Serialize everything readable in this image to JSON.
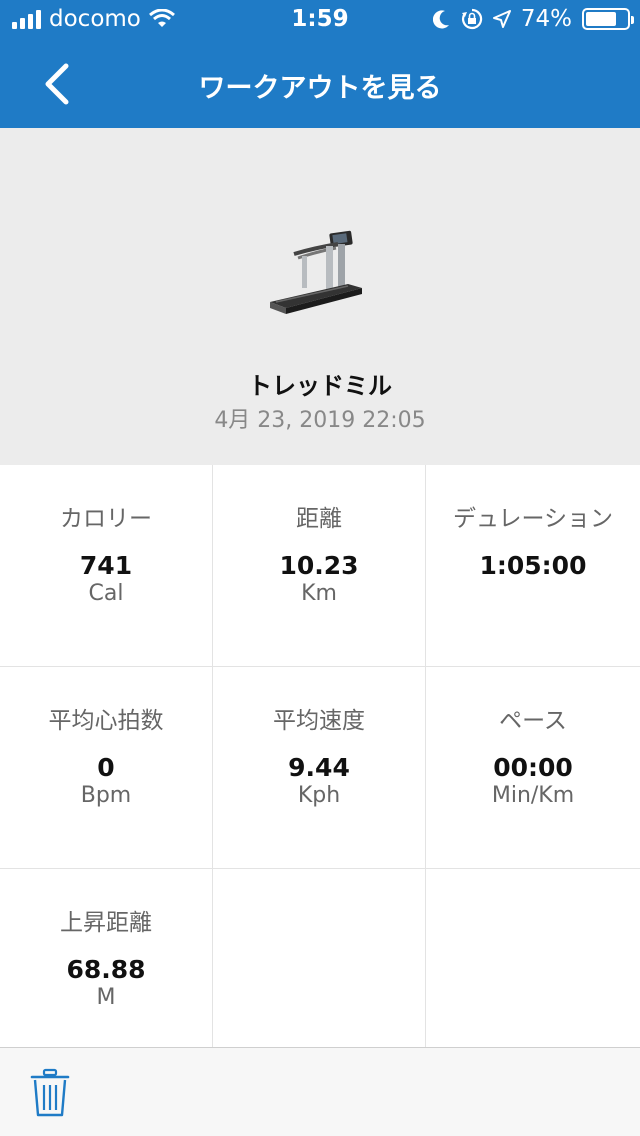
{
  "status_bar": {
    "carrier": "docomo",
    "time": "1:59",
    "battery_percent": "74%",
    "battery_level": 0.74,
    "icons": [
      "signal-bars-icon",
      "wifi-icon",
      "moon-icon",
      "orientation-lock-icon",
      "location-arrow-icon",
      "battery-icon"
    ]
  },
  "nav": {
    "title": "ワークアウトを見る",
    "back_icon": "chevron-left-icon"
  },
  "workout": {
    "equipment_name": "トレッドミル",
    "date": "4月 23, 2019 22:05",
    "image": "treadmill-image"
  },
  "stats": [
    {
      "label": "カロリー",
      "value": "741",
      "unit": "Cal"
    },
    {
      "label": "距離",
      "value": "10.23",
      "unit": "Km"
    },
    {
      "label": "デュレーション",
      "value": "1:05:00",
      "unit": ""
    },
    {
      "label": "平均心拍数",
      "value": "0",
      "unit": "Bpm"
    },
    {
      "label": "平均速度",
      "value": "9.44",
      "unit": "Kph"
    },
    {
      "label": "ペース",
      "value": "00:00",
      "unit": "Min/Km"
    },
    {
      "label": "上昇距離",
      "value": "68.88",
      "unit": "M"
    }
  ],
  "footer": {
    "delete_icon": "trash-icon"
  },
  "colors": {
    "header_blue": "#1f7bc6",
    "trash_blue": "#1f7bc6",
    "background_gray": "#ececec"
  }
}
